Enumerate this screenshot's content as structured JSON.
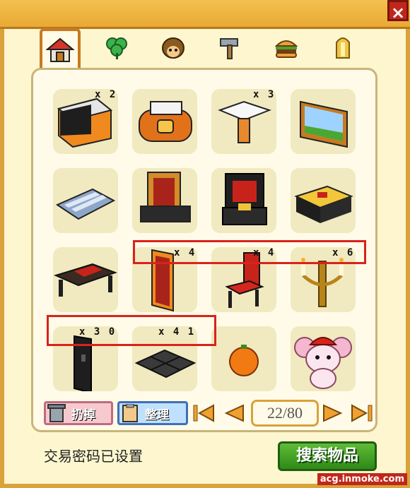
{
  "window": {
    "close_glyph": "×"
  },
  "tabs": [
    {
      "name": "house",
      "icon": "house-icon",
      "active": true
    },
    {
      "name": "plant",
      "icon": "clover-icon",
      "active": false
    },
    {
      "name": "character",
      "icon": "hedgehog-icon",
      "active": false
    },
    {
      "name": "tools",
      "icon": "hammer-icon",
      "active": false
    },
    {
      "name": "food",
      "icon": "burger-icon",
      "active": false
    },
    {
      "name": "misc",
      "icon": "bell-icon",
      "active": false
    }
  ],
  "items": [
    {
      "name": "black-counter",
      "qty": "x 2"
    },
    {
      "name": "orange-sofa",
      "qty": ""
    },
    {
      "name": "white-table",
      "qty": "x 3"
    },
    {
      "name": "landscape-painting",
      "qty": ""
    },
    {
      "name": "striped-rug",
      "qty": ""
    },
    {
      "name": "window-screen-shelf",
      "qty": ""
    },
    {
      "name": "red-throne-seat",
      "qty": ""
    },
    {
      "name": "gold-chest",
      "qty": ""
    },
    {
      "name": "dark-long-table",
      "qty": ""
    },
    {
      "name": "red-door",
      "qty": "x 4"
    },
    {
      "name": "red-chair",
      "qty": "x 4"
    },
    {
      "name": "candelabra",
      "qty": "x 6"
    },
    {
      "name": "black-pillar",
      "qty": "x 3 0"
    },
    {
      "name": "dark-floor-tile",
      "qty": "x 4 1"
    },
    {
      "name": "orange",
      "qty": ""
    },
    {
      "name": "pink-mouse-doll",
      "qty": ""
    }
  ],
  "toolbar": {
    "discard_label": "扔掉",
    "sort_label": "整理"
  },
  "pager": {
    "current": "22",
    "total": "80",
    "display": "22/80"
  },
  "footer": {
    "status_text": "交易密码已设置",
    "search_label": "搜索物品"
  },
  "watermark": "acg.inmoke.com"
}
